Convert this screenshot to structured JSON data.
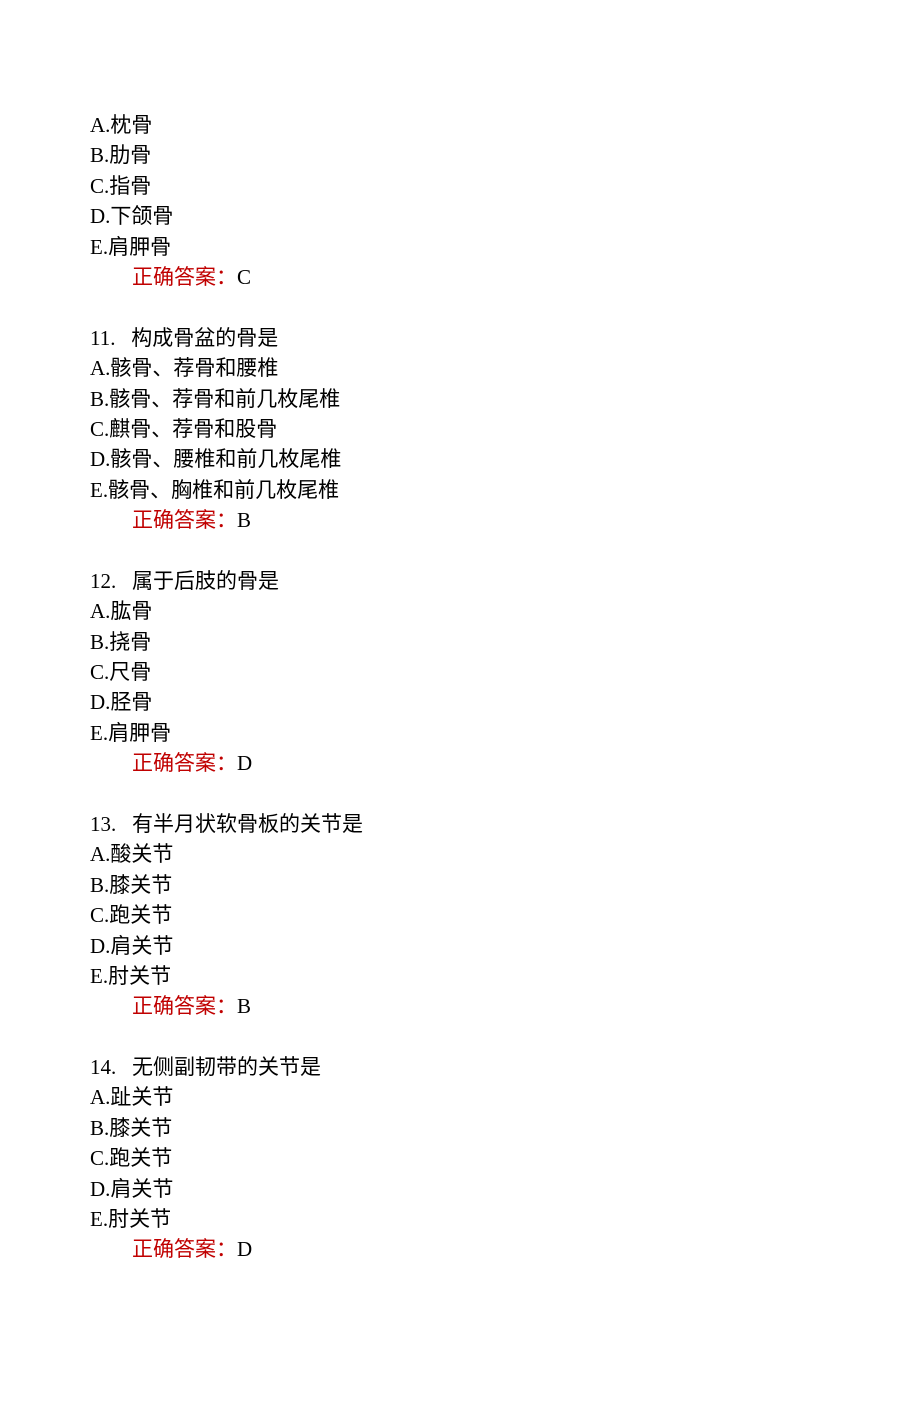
{
  "q10": {
    "options": {
      "A": "A.枕骨",
      "B": "B.肋骨",
      "C": "C.指骨",
      "D": "D.下颌骨",
      "E": "E.肩胛骨"
    },
    "answer_label": "正确答案：",
    "answer_value": "C"
  },
  "q11": {
    "number": "11.",
    "text": "构成骨盆的骨是",
    "options": {
      "A": "A.骸骨、荐骨和腰椎",
      "B": "B.骸骨、荐骨和前几枚尾椎",
      "C": "C.麒骨、荐骨和股骨",
      "D": "D.骸骨、腰椎和前几枚尾椎",
      "E": "E.骸骨、胸椎和前几枚尾椎"
    },
    "answer_label": "正确答案：",
    "answer_value": "B"
  },
  "q12": {
    "number": "12.",
    "text": "属于后肢的骨是",
    "options": {
      "A": "A.肱骨",
      "B": "B.挠骨",
      "C": "C.尺骨",
      "D": "D.胫骨",
      "E": "E.肩胛骨"
    },
    "answer_label": "正确答案：",
    "answer_value": "D"
  },
  "q13": {
    "number": "13.",
    "text": "有半月状软骨板的关节是",
    "options": {
      "A": "A.酸关节",
      "B": "B.膝关节",
      "C": "C.跑关节",
      "D": "D.肩关节",
      "E": "E.肘关节"
    },
    "answer_label": "正确答案：",
    "answer_value": "B"
  },
  "q14": {
    "number": "14.",
    "text": "无侧副韧带的关节是",
    "options": {
      "A": "A.趾关节",
      "B": "B.膝关节",
      "C": "C.跑关节",
      "D": "D.肩关节",
      "E": "E.肘关节"
    },
    "answer_label": "正确答案：",
    "answer_value": "D"
  }
}
